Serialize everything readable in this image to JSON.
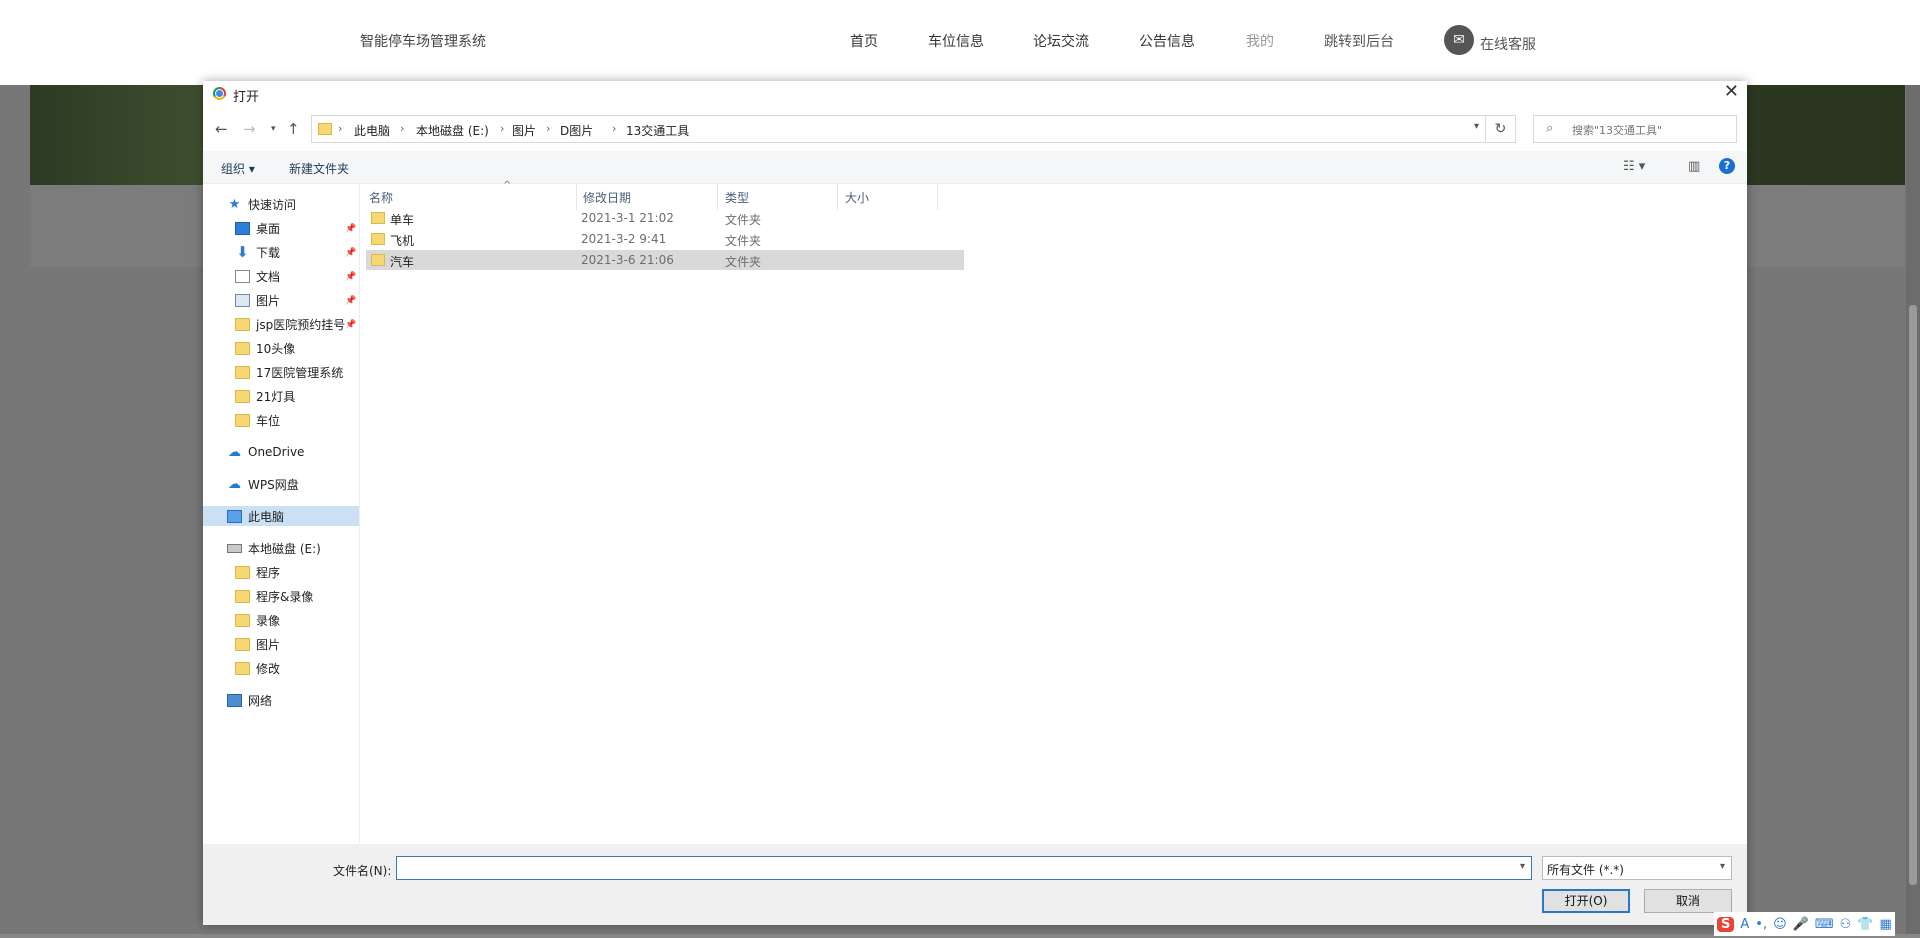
{
  "site": {
    "title": "智能停车场管理系统",
    "nav": [
      "首页",
      "车位信息",
      "论坛交流",
      "公告信息",
      "我的",
      "跳转到后台"
    ],
    "service": "在线客服"
  },
  "dialog": {
    "title": "打开",
    "breadcrumb": [
      "此电脑",
      "本地磁盘 (E:)",
      "图片",
      "D图片",
      "13交通工具"
    ],
    "search_placeholder": "搜索\"13交通工具\"",
    "toolbar": {
      "organize": "组织 ▾",
      "new_folder": "新建文件夹"
    },
    "nav_pane": {
      "quick_access": "快速访问",
      "quick_items": [
        "桌面",
        "下载",
        "文档",
        "图片",
        "jsp医院预约挂号",
        "10头像",
        "17医院管理系统",
        "21灯具",
        "车位"
      ],
      "onedrive": "OneDrive",
      "wps": "WPS网盘",
      "this_pc": "此电脑",
      "drive": "本地磁盘 (E:)",
      "drive_items": [
        "程序",
        "程序&录像",
        "录像",
        "图片",
        "修改"
      ],
      "network": "网络"
    },
    "columns": {
      "name": "名称",
      "date": "修改日期",
      "type": "类型",
      "size": "大小"
    },
    "files": [
      {
        "name": "单车",
        "date": "2021-3-1 21:02",
        "type": "文件夹"
      },
      {
        "name": "飞机",
        "date": "2021-3-2 9:41",
        "type": "文件夹"
      },
      {
        "name": "汽车",
        "date": "2021-3-6 21:06",
        "type": "文件夹",
        "selected": true
      }
    ],
    "filename_label": "文件名(N):",
    "filename_value": "",
    "filter": "所有文件 (*.*)",
    "open_button": "打开(O)",
    "cancel_button": "取消"
  },
  "colors": {
    "accent": "#2b77c7",
    "selection": "#d9d9d9",
    "nav_selection": "#cce0f5"
  }
}
